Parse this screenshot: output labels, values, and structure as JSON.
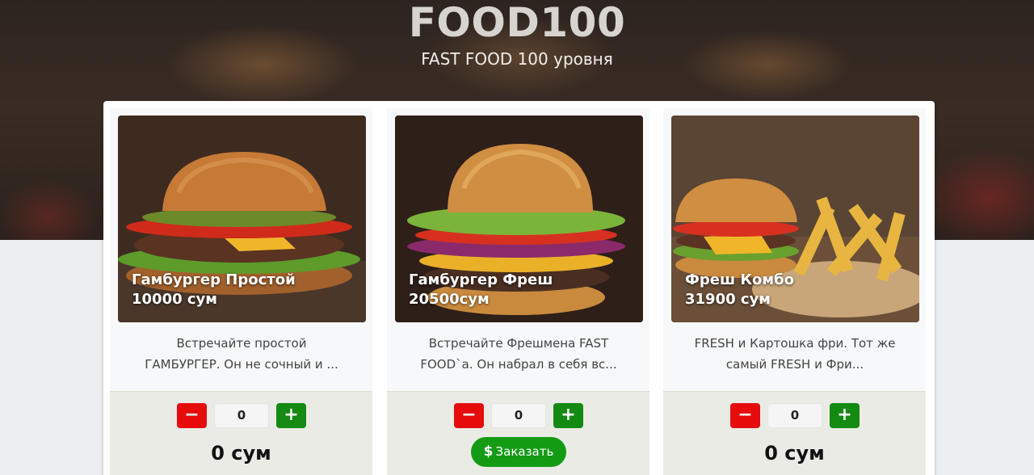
{
  "header": {
    "brand": "FOOD100",
    "tagline": "FAST FOOD 100 уровня"
  },
  "products": [
    {
      "name": "Гамбургер Простой",
      "price": "10000 сум",
      "description_line1": "Встречайте простой",
      "description_line2": "ГАМБУРГЕР. Он не сочный и ...",
      "quantity": "0",
      "total": "0 сум",
      "minus_label": "−",
      "plus_label": "+"
    },
    {
      "name": "Гамбургер Фреш",
      "price": "20500сум",
      "description_line1": "Встречайте Фрешмена FAST",
      "description_line2": "FOOD`а. Он набрал в себя вс...",
      "quantity": "0",
      "order_label": "Заказать",
      "order_icon": "$",
      "minus_label": "−",
      "plus_label": "+"
    },
    {
      "name": "Фреш Комбо",
      "price": "31900 сум",
      "description_line1": "FRESH и Картошка фри. Тот же",
      "description_line2": "самый FRESH и Фри...",
      "quantity": "0",
      "total": "0 сум",
      "minus_label": "−",
      "plus_label": "+"
    }
  ],
  "colors": {
    "minus": "#e60c0c",
    "plus": "#138a12",
    "order": "#149b14"
  }
}
